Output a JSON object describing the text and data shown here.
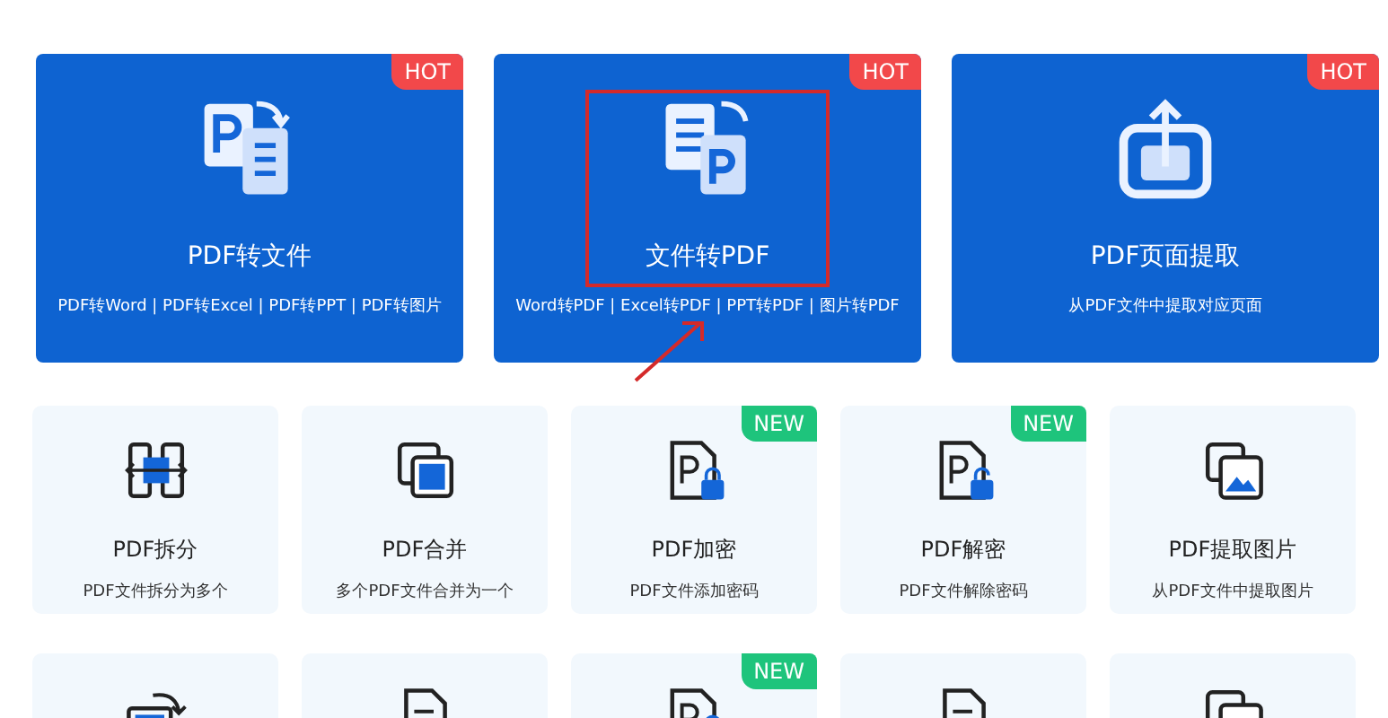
{
  "featured": [
    {
      "title": "PDF转文件",
      "subtitle": "PDF转Word | PDF转Excel | PDF转PPT | PDF转图片",
      "badge": {
        "kind": "hot",
        "text": "HOT"
      }
    },
    {
      "title": "文件转PDF",
      "subtitle": "Word转PDF | Excel转PDF | PPT转PDF | 图片转PDF",
      "badge": {
        "kind": "hot",
        "text": "HOT"
      }
    },
    {
      "title": "PDF页面提取",
      "subtitle": "从PDF文件中提取对应页面",
      "badge": {
        "kind": "hot",
        "text": "HOT"
      }
    }
  ],
  "tools": [
    {
      "title": "PDF拆分",
      "subtitle": "PDF文件拆分为多个"
    },
    {
      "title": "PDF合并",
      "subtitle": "多个PDF文件合并为一个"
    },
    {
      "title": "PDF加密",
      "subtitle": "PDF文件添加密码",
      "badge": {
        "kind": "new",
        "text": "NEW"
      }
    },
    {
      "title": "PDF解密",
      "subtitle": "PDF文件解除密码",
      "badge": {
        "kind": "new",
        "text": "NEW"
      }
    },
    {
      "title": "PDF提取图片",
      "subtitle": "从PDF文件中提取图片"
    }
  ],
  "more_tools": [
    {
      "new": false
    },
    {
      "new": false
    },
    {
      "new": true,
      "badge": "NEW"
    },
    {
      "new": false
    },
    {
      "new": false
    }
  ],
  "annotation": {
    "highlight": true
  }
}
